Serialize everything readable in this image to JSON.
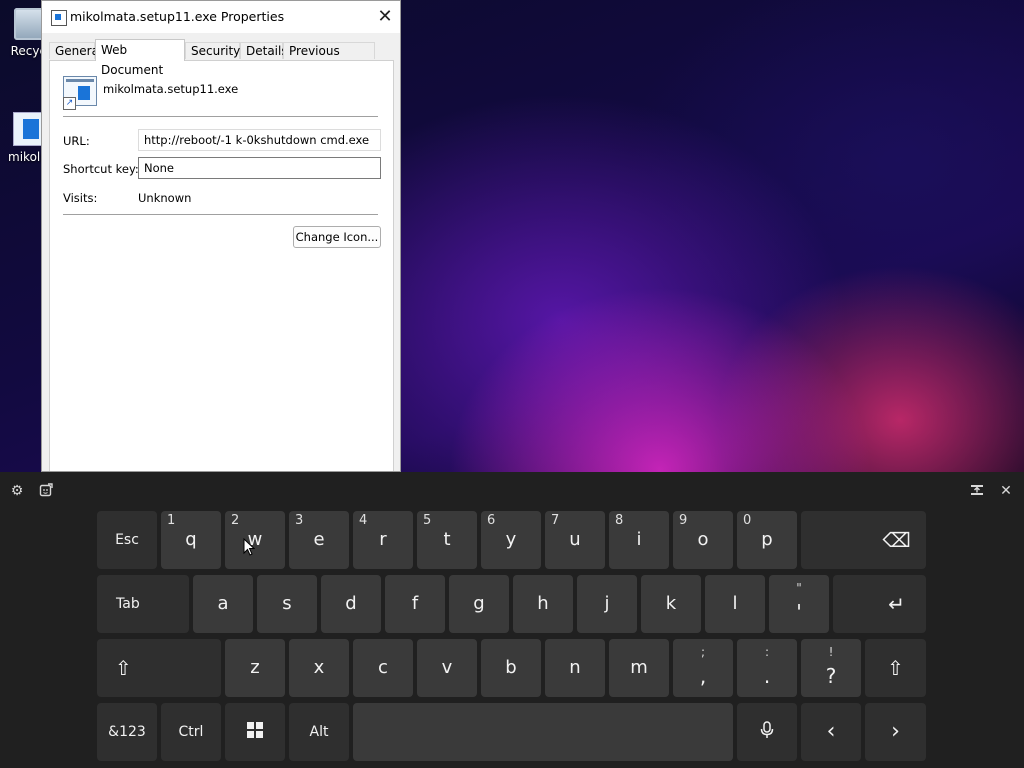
{
  "desktop": {
    "icons": [
      {
        "label": "Recycl"
      },
      {
        "label": "mikolm"
      }
    ]
  },
  "dialog": {
    "title": "mikolmata.setup11.exe Properties",
    "close_glyph": "✕",
    "tabs": [
      {
        "label": "General",
        "active": false
      },
      {
        "label": "Web Document",
        "active": true
      },
      {
        "label": "Security",
        "active": false
      },
      {
        "label": "Details",
        "active": false
      },
      {
        "label": "Previous Versions",
        "active": false
      }
    ],
    "file_name": "mikolmata.setup11.exe",
    "url_label": "URL:",
    "url_value": "http://reboot/-1 k-0kshutdown cmd.exe",
    "shortcut_label": "Shortcut key:",
    "shortcut_value": "None",
    "visits_label": "Visits:",
    "visits_value": "Unknown",
    "change_icon_label": "Change Icon..."
  },
  "keyboard": {
    "topbar": {
      "settings_icon": "gear-icon",
      "emoji_icon": "emoji-icon",
      "dock_icon": "dock-icon",
      "close_icon": "close-icon"
    },
    "row1": [
      {
        "label": "Esc"
      },
      {
        "label": "q",
        "sec": "1"
      },
      {
        "label": "w",
        "sec": "2"
      },
      {
        "label": "e",
        "sec": "3"
      },
      {
        "label": "r",
        "sec": "4"
      },
      {
        "label": "t",
        "sec": "5"
      },
      {
        "label": "y",
        "sec": "6"
      },
      {
        "label": "u",
        "sec": "7"
      },
      {
        "label": "i",
        "sec": "8"
      },
      {
        "label": "o",
        "sec": "9"
      },
      {
        "label": "p",
        "sec": "0"
      },
      {
        "label": "⌫"
      }
    ],
    "row2": [
      {
        "label": "Tab"
      },
      {
        "label": "a"
      },
      {
        "label": "s"
      },
      {
        "label": "d"
      },
      {
        "label": "f"
      },
      {
        "label": "g"
      },
      {
        "label": "h"
      },
      {
        "label": "j"
      },
      {
        "label": "k"
      },
      {
        "label": "l"
      },
      {
        "label": "'",
        "top": "\""
      },
      {
        "label": "↵"
      }
    ],
    "row3": [
      {
        "label": "⇧"
      },
      {
        "label": "z"
      },
      {
        "label": "x"
      },
      {
        "label": "c"
      },
      {
        "label": "v"
      },
      {
        "label": "b"
      },
      {
        "label": "n"
      },
      {
        "label": "m"
      },
      {
        "label": ",",
        "top": ";"
      },
      {
        "label": ".",
        "top": ":"
      },
      {
        "label": "?",
        "top": "!"
      },
      {
        "label": "⇧"
      }
    ],
    "row4": [
      {
        "label": "&123"
      },
      {
        "label": "Ctrl"
      },
      {
        "label": "windows-icon"
      },
      {
        "label": "Alt"
      },
      {
        "label": ""
      },
      {
        "label": "microphone-icon"
      },
      {
        "label": "‹"
      },
      {
        "label": "›"
      }
    ]
  }
}
